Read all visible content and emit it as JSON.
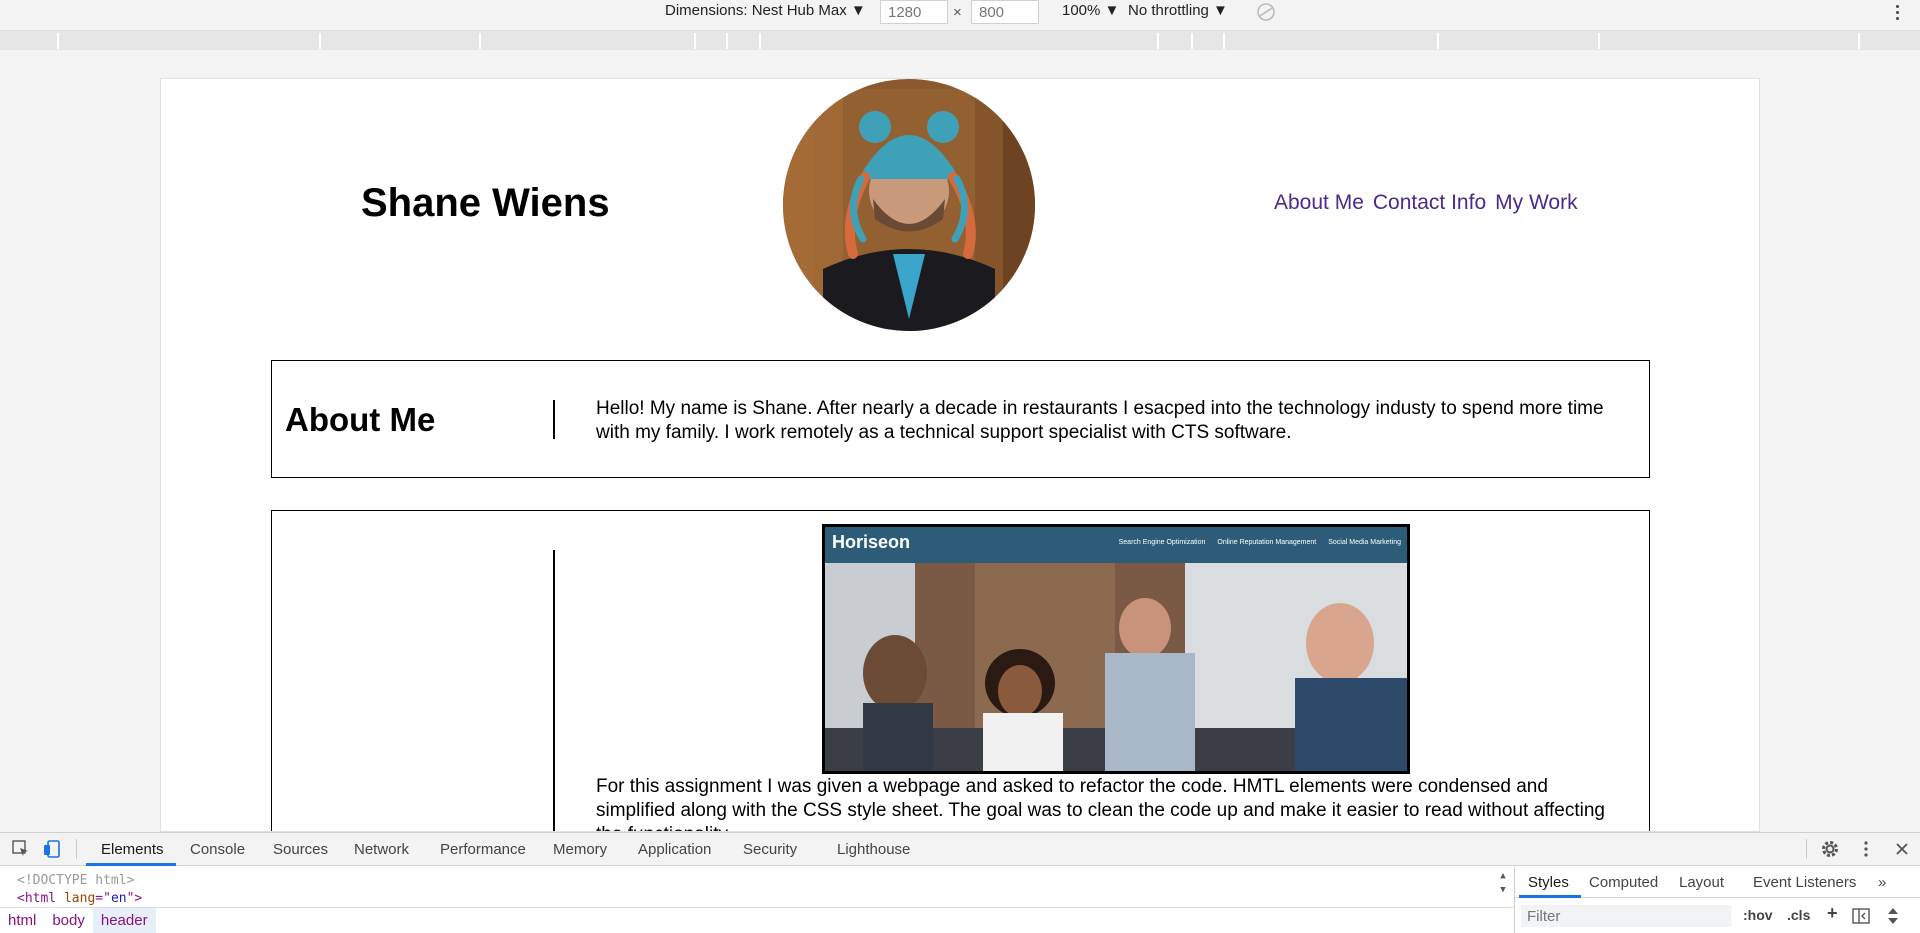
{
  "device_toolbar": {
    "dimensions_label": "Dimensions: Nest Hub Max ▼",
    "width_value": "1280",
    "height_value": "800",
    "times": "×",
    "zoom_label": "100% ▼",
    "throttle_label": "No throttling ▼"
  },
  "page": {
    "title": "Shane Wiens",
    "nav": [
      "About Me",
      "Contact Info",
      "My Work"
    ],
    "about": {
      "heading": "About Me",
      "text": "Hello! My name is Shane. After nearly a decade in restaurants I esacped into the technology industy to spend more time with my family. I work remotely as a technical support specialist with CTS software."
    },
    "work": {
      "project_logo": "Horiseon",
      "project_nav": [
        "Search Engine Optimization",
        "Online Reputation Management",
        "Social Media Marketing"
      ],
      "text": "For this assignment I was given a webpage and asked to refactor the code. HMTL elements were condensed and simplified along with the CSS style sheet. The goal was to clean the code up and make it easier to read without affecting the functionality."
    },
    "colors": {
      "nav_link": "#4a2a8a",
      "project_header": "#2d5c78"
    }
  },
  "devtools": {
    "tabs": [
      "Elements",
      "Console",
      "Sources",
      "Network",
      "Performance",
      "Memory",
      "Application",
      "Security",
      "Lighthouse"
    ],
    "active_tab": "Elements",
    "dom": {
      "doctype": "<!DOCTYPE html>",
      "html_open": "<html",
      "lang_attr": "lang",
      "lang_eq": "=\"",
      "lang_val": "en",
      "html_close": "\">"
    },
    "breadcrumbs": [
      "html",
      "body",
      "header"
    ],
    "side_tabs": [
      "Styles",
      "Computed",
      "Layout",
      "Event Listeners"
    ],
    "side_more": "»",
    "filter_placeholder": "Filter",
    "hov": ":hov",
    "cls": ".cls",
    "plus": "+"
  }
}
